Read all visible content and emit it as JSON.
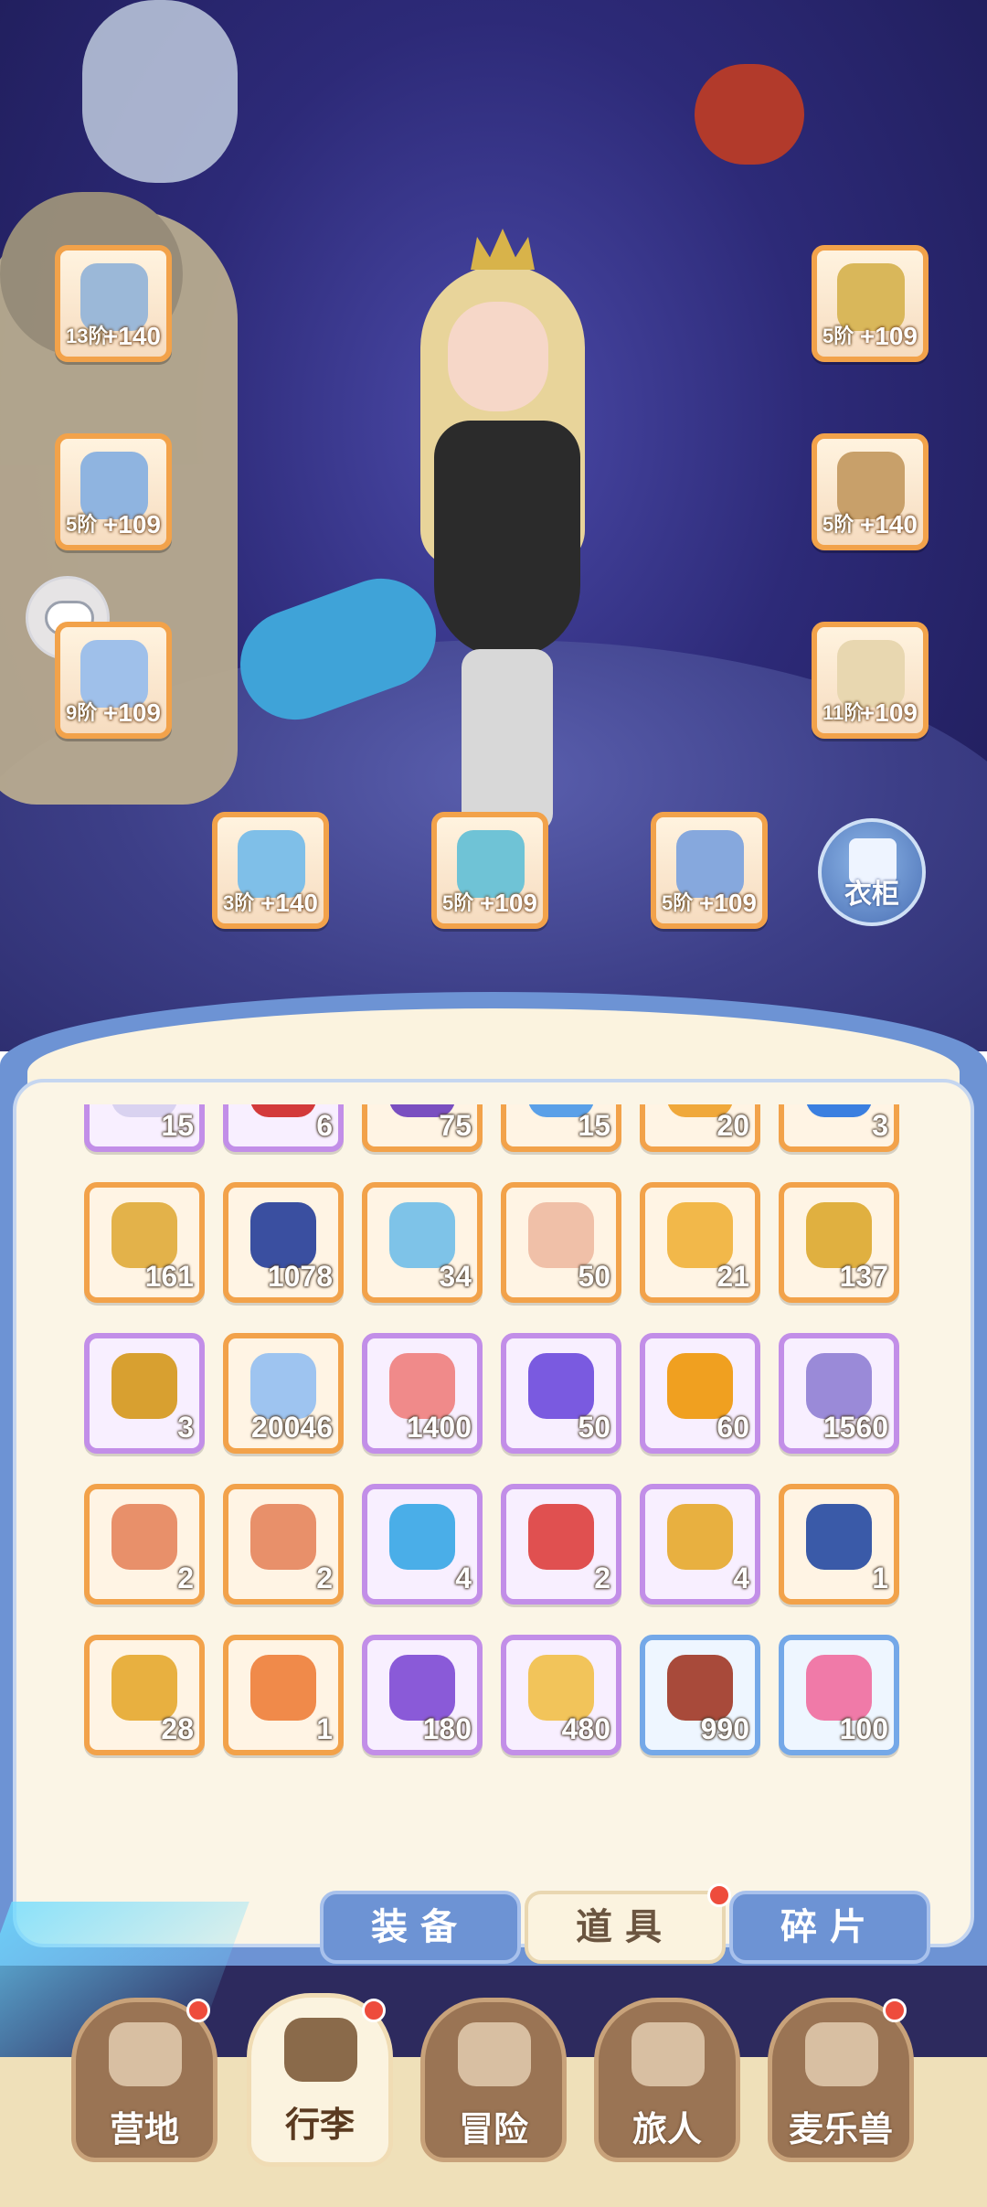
{
  "equipment": {
    "slots": [
      {
        "id": "weapon",
        "tier": "13阶",
        "bonus": "+140",
        "rarity": "orange",
        "icon": "halberd-icon",
        "color": "#9bb8d8"
      },
      {
        "id": "armor",
        "tier": "5阶",
        "bonus": "+109",
        "rarity": "orange",
        "icon": "chest-armor-icon",
        "color": "#8fb4e0"
      },
      {
        "id": "bracer",
        "tier": "9阶",
        "bonus": "+109",
        "rarity": "orange",
        "icon": "pauldron-icon",
        "color": "#9fc0ea"
      },
      {
        "id": "helmet",
        "tier": "5阶",
        "bonus": "+109",
        "rarity": "orange",
        "icon": "helmet-icon",
        "color": "#d9b75a"
      },
      {
        "id": "gloves",
        "tier": "5阶",
        "bonus": "+140",
        "rarity": "orange",
        "icon": "gauntlet-icon",
        "color": "#c8a06a"
      },
      {
        "id": "boots",
        "tier": "11阶",
        "bonus": "+109",
        "rarity": "orange",
        "icon": "boots-icon",
        "color": "#e8d7b0"
      },
      {
        "id": "ring",
        "tier": "3阶",
        "bonus": "+140",
        "rarity": "orange",
        "icon": "ring-icon",
        "color": "#7fbfe8"
      },
      {
        "id": "necklace",
        "tier": "5阶",
        "bonus": "+109",
        "rarity": "orange",
        "icon": "necklace-icon",
        "color": "#6fc3d6"
      },
      {
        "id": "charm",
        "tier": "5阶",
        "bonus": "+109",
        "rarity": "orange",
        "icon": "charm-icon",
        "color": "#86a8dd"
      }
    ],
    "wardrobe_label": "衣柜"
  },
  "inventory": {
    "items": [
      {
        "qty": "15",
        "rarity": "purple",
        "icon": "crystal-shard-icon",
        "color": "#d9d2f0"
      },
      {
        "qty": "6",
        "rarity": "purple",
        "icon": "red-orb-icon",
        "color": "#d33a3a"
      },
      {
        "qty": "75",
        "rarity": "orange",
        "icon": "purple-ticket-icon",
        "color": "#7a4fc0"
      },
      {
        "qty": "15",
        "rarity": "orange",
        "icon": "blue-origami-icon",
        "color": "#5aa0e8"
      },
      {
        "qty": "20",
        "rarity": "orange",
        "icon": "orange-gem-icon",
        "color": "#f0a83a"
      },
      {
        "qty": "3",
        "rarity": "orange",
        "icon": "blue-gem-icon",
        "color": "#3a7fe0"
      },
      {
        "qty": "161",
        "rarity": "orange",
        "icon": "lyre-icon",
        "color": "#e3b24a"
      },
      {
        "qty": "1078",
        "rarity": "orange",
        "icon": "cat-orb-icon",
        "color": "#3a4fa0"
      },
      {
        "qty": "34",
        "rarity": "orange",
        "icon": "ice-crystal-icon",
        "color": "#7ec3e8"
      },
      {
        "qty": "50",
        "rarity": "orange",
        "icon": "paint-tube-icon",
        "color": "#f0c0a8"
      },
      {
        "qty": "21",
        "rarity": "orange",
        "icon": "gold-card-icon",
        "color": "#f2b84a"
      },
      {
        "qty": "137",
        "rarity": "orange",
        "icon": "bell-icon",
        "color": "#e0b040"
      },
      {
        "qty": "3",
        "rarity": "purple",
        "icon": "horseshoe-icon",
        "color": "#d8a030"
      },
      {
        "qty": "20046",
        "rarity": "orange",
        "icon": "star-crystal-icon",
        "color": "#9ec4f0"
      },
      {
        "qty": "1400",
        "rarity": "purple",
        "icon": "heart-icon",
        "color": "#f08a8a"
      },
      {
        "qty": "50",
        "rarity": "purple",
        "icon": "purple-crystal-icon",
        "color": "#7a5ae0"
      },
      {
        "qty": "60",
        "rarity": "purple",
        "icon": "amber-gem-icon",
        "color": "#f0a020"
      },
      {
        "qty": "1560",
        "rarity": "purple",
        "icon": "heart-coin-icon",
        "color": "#9a8ad8"
      },
      {
        "qty": "2",
        "rarity": "orange",
        "icon": "ore-sword-icon",
        "color": "#e8906a"
      },
      {
        "qty": "2",
        "rarity": "orange",
        "icon": "ore-paw-icon",
        "color": "#e8906a"
      },
      {
        "qty": "4",
        "rarity": "purple",
        "icon": "blue-potion-icon",
        "color": "#4aaee8"
      },
      {
        "qty": "2",
        "rarity": "purple",
        "icon": "red-potion-icon",
        "color": "#e05050"
      },
      {
        "qty": "4",
        "rarity": "purple",
        "icon": "gold-key-icon",
        "color": "#e8b040"
      },
      {
        "qty": "1",
        "rarity": "orange",
        "icon": "blue-eye-card-icon",
        "color": "#3a5aa8"
      },
      {
        "qty": "28",
        "rarity": "orange",
        "icon": "gold-eye-card-icon",
        "color": "#e8b040"
      },
      {
        "qty": "1",
        "rarity": "orange",
        "icon": "orange-eye-card-icon",
        "color": "#f08a4a"
      },
      {
        "qty": "180",
        "rarity": "purple",
        "icon": "cat-mirror-icon",
        "color": "#8a5ad8"
      },
      {
        "qty": "480",
        "rarity": "purple",
        "icon": "cheese-icon",
        "color": "#f2c45a"
      },
      {
        "qty": "990",
        "rarity": "blue",
        "icon": "meat-icon",
        "color": "#a84a3a"
      },
      {
        "qty": "100",
        "rarity": "blue",
        "icon": "lollipop-icon",
        "color": "#f07aa8"
      }
    ]
  },
  "tabs": [
    {
      "label": "装备",
      "active": false
    },
    {
      "label": "道具",
      "active": true,
      "badge": true
    },
    {
      "label": "碎片",
      "active": false
    }
  ],
  "nav": [
    {
      "label": "营地",
      "icon": "castle-icon",
      "badge": true,
      "active": false
    },
    {
      "label": "行李",
      "icon": "backpack-icon",
      "badge": true,
      "active": true
    },
    {
      "label": "冒险",
      "icon": "crossed-swords-icon",
      "badge": false,
      "active": false
    },
    {
      "label": "旅人",
      "icon": "character-icon",
      "badge": false,
      "active": false
    },
    {
      "label": "麦乐兽",
      "icon": "pet-icon",
      "badge": true,
      "active": false
    }
  ]
}
